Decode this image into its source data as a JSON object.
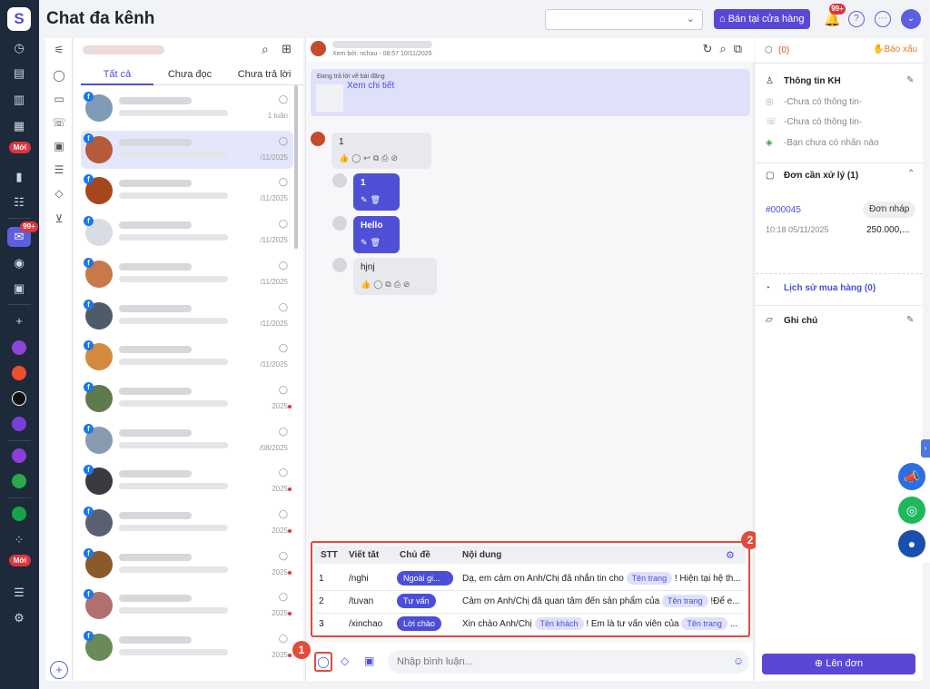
{
  "header": {
    "title": "Chat đa kênh",
    "store_button": "Bán tại cửa hàng",
    "notif_badge": "99+"
  },
  "nav": {
    "new_badge": "Mới",
    "new_badge2": "Mới",
    "chat_badge": "99+"
  },
  "list": {
    "tabs": [
      "Tất cả",
      "Chưa đọc",
      "Chưa trả lời"
    ],
    "rows": [
      {
        "date": "1 tuần",
        "selected": false,
        "pic": "#7e9bb8"
      },
      {
        "date": "/11/2025",
        "selected": true,
        "pic": "#b55a3a"
      },
      {
        "date": "/11/2025",
        "selected": false,
        "pic": "#a6461f"
      },
      {
        "date": "/11/2025",
        "selected": false,
        "pic": "#d9dce2"
      },
      {
        "date": "/11/2025",
        "selected": false,
        "pic": "#c9784a"
      },
      {
        "date": "/11/2025",
        "selected": false,
        "pic": "#4f5a6a"
      },
      {
        "date": "/11/2025",
        "selected": false,
        "pic": "#d48a3e"
      },
      {
        "date": "2025",
        "selected": false,
        "pic": "#5f7a4c"
      },
      {
        "date": "/08/2025",
        "selected": false,
        "pic": "#8a9bb0"
      },
      {
        "date": "2025",
        "selected": false,
        "pic": "#3a3a40"
      },
      {
        "date": "2025",
        "selected": false,
        "pic": "#5a6070"
      },
      {
        "date": "2025",
        "selected": false,
        "pic": "#8a5a2a"
      },
      {
        "date": "2025",
        "selected": false,
        "pic": "#b07070"
      },
      {
        "date": "2025",
        "selected": false,
        "pic": "#6a8a5a"
      }
    ]
  },
  "chat": {
    "subtitle": "Xem bởi: nchau - 08:57 10/11/2025",
    "post_label": "Đang trả lời về bài đăng",
    "post_link": "Xem chi tiết",
    "messages": [
      {
        "text": "1"
      },
      {
        "text": "1"
      },
      {
        "text": "Hello"
      },
      {
        "text": "hjnj"
      }
    ]
  },
  "quick_reply": {
    "headers": [
      "STT",
      "Viết tắt",
      "Chủ đề",
      "Nội dung"
    ],
    "rows": [
      {
        "stt": "1",
        "abbr": "/nghi",
        "topic": "Ngoài gi...",
        "pre": "Dạ, em cảm ơn Anh/Chị đã nhắn tin cho",
        "tag": "Tên trang",
        "post": "! Hiện tại hệ th..."
      },
      {
        "stt": "2",
        "abbr": "/tuvan",
        "topic": "Tư vấn",
        "pre": "Cảm ơn Anh/Chị đã quan tâm đến sản phẩm của",
        "tag": "Tên trang",
        "post": "!Để e..."
      },
      {
        "stt": "3",
        "abbr": "/xinchao",
        "topic": "Lời chào",
        "pre": "Xin chào Anh/Chị",
        "tag": "Tên khách",
        "post": "! Em là tư vấn viên của",
        "tag2": "Tên trang",
        "post2": "..."
      }
    ]
  },
  "annotations": {
    "one": "1",
    "two": "2"
  },
  "composer": {
    "placeholder": "Nhập bình luận..."
  },
  "right": {
    "count": "(0)",
    "report": "Báo xấu",
    "info_title": "Thông tin KH",
    "info1": "-Chưa có thông tin-",
    "info2": "-Chưa có thông tin-",
    "info3": "-Bạn chưa có nhãn nào",
    "orders_title": "Đơn cần xử lý (1)",
    "order_id": "#000045",
    "order_status": "Đơn nháp",
    "order_date": "10:18 05/11/2025",
    "order_amount": "250.000,...",
    "history": "Lịch sử mua hàng (0)",
    "notes": "Ghi chú",
    "create_order": "Lên đơn"
  }
}
